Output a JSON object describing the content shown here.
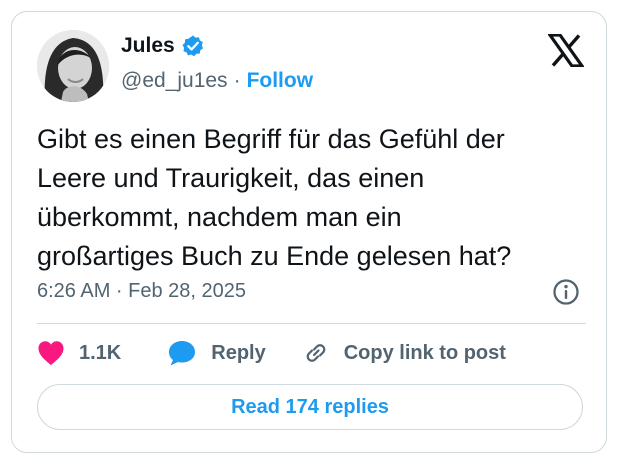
{
  "author": {
    "name": "Jules",
    "handle": "@ed_ju1es",
    "separator": "·",
    "follow_label": "Follow",
    "verified_color": "#1d9bf0"
  },
  "tweet": {
    "text": "Gibt es einen Begriff für das Gefühl der\nLeere und Traurigkeit, das einen\nüberkommt, nachdem man ein\ngroßartiges Buch zu Ende gelesen hat?",
    "timestamp": "6:26 AM · Feb 28, 2025"
  },
  "actions": {
    "likes": "1.1K",
    "reply_label": "Reply",
    "copy_link_label": "Copy link to post"
  },
  "read_replies_label": "Read 174 replies",
  "icons": [
    "x-logo-icon",
    "verified-badge-icon",
    "info-icon",
    "heart-icon",
    "reply-bubble-icon",
    "link-icon"
  ],
  "colors": {
    "accent": "#1d9bf0",
    "like": "#f91880",
    "text": "#0f1419",
    "secondary": "#536471",
    "border": "#cfd9de"
  }
}
